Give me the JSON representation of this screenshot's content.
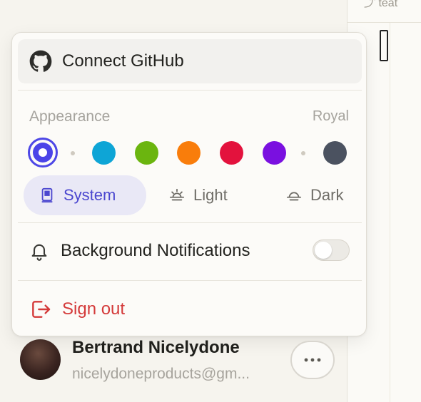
{
  "background": {
    "top_tab_fragment": "⤴ teat"
  },
  "menu": {
    "connect": {
      "label": "Connect GitHub",
      "icon": "github-icon"
    },
    "appearance": {
      "label": "Appearance",
      "current_theme": "Royal",
      "swatches": [
        {
          "name": "royal",
          "color": "#4b44e8",
          "selected": true
        },
        {
          "name": "cyan",
          "color": "#0ea5d6"
        },
        {
          "name": "green",
          "color": "#6bb50f"
        },
        {
          "name": "orange",
          "color": "#f97d0b"
        },
        {
          "name": "red",
          "color": "#e3123d"
        },
        {
          "name": "purple",
          "color": "#7a10e0"
        },
        {
          "name": "slate",
          "color": "#4b5260"
        }
      ],
      "modes": [
        {
          "label": "System",
          "icon": "system-icon",
          "active": true
        },
        {
          "label": "Light",
          "icon": "sun-icon",
          "active": false
        },
        {
          "label": "Dark",
          "icon": "moon-icon",
          "active": false
        }
      ]
    },
    "notifications": {
      "label": "Background Notifications",
      "icon": "bell-icon",
      "enabled": false
    },
    "sign_out": {
      "label": "Sign out",
      "icon": "sign-out-icon",
      "color": "#d43a3a"
    }
  },
  "profile": {
    "name": "Bertrand Nicelydone",
    "email": "nicelydoneproducts@gm..."
  }
}
